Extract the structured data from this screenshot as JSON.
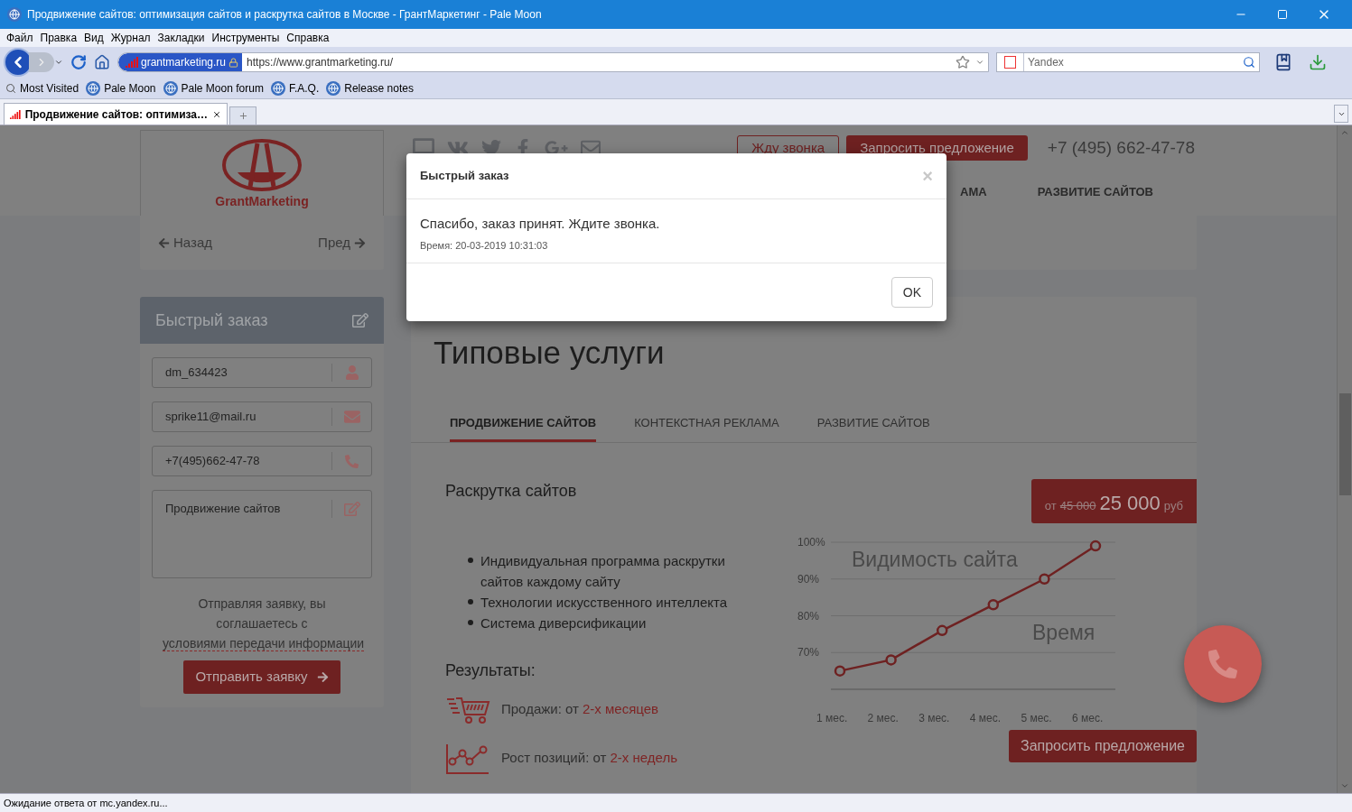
{
  "window": {
    "title": "Продвижение сайтов: оптимизация сайтов и раскрутка сайтов в Москве - ГрантМаркетинг - Pale Moon"
  },
  "menu": [
    "Файл",
    "Правка",
    "Вид",
    "Журнал",
    "Закладки",
    "Инструменты",
    "Справка"
  ],
  "toolbar": {
    "site_identity": "grantmarketing.ru",
    "url": "https://www.grantmarketing.ru/",
    "search_placeholder": "Yandex"
  },
  "bookmarks": [
    "Most Visited",
    "Pale Moon",
    "Pale Moon forum",
    "F.A.Q.",
    "Release notes"
  ],
  "tabs": [
    {
      "label": "Продвижение сайтов: оптимиза…",
      "selected": true
    }
  ],
  "page": {
    "logo": "GrantMarketing",
    "header_buttons": [
      {
        "label": "Жду звонка",
        "kind": "outline"
      },
      {
        "label": "Запросить предложение",
        "kind": "filled"
      }
    ],
    "phone": "+7 (495) 662-47-78",
    "nav": [
      "АМА",
      "РАЗВИТИЕ САЙТОВ"
    ],
    "pager": {
      "prev": "Назад",
      "next": "Пред"
    },
    "quick_order": {
      "title": "Быстрый заказ",
      "fields": [
        {
          "kind": "name",
          "value": "dm_634423"
        },
        {
          "kind": "email",
          "value": "sprike11@mail.ru"
        },
        {
          "kind": "phone",
          "value": "+7(495)662-47-78"
        },
        {
          "kind": "message",
          "value": "Продвижение сайтов"
        }
      ],
      "consent": "Отправляя заявку, вы соглашаетесь с",
      "consent_link": "условиями передачи информации",
      "submit": "Отправить заявку"
    },
    "services": {
      "title": "Типовые услуги",
      "tabs": [
        {
          "label": "ПРОДВИЖЕНИЕ САЙТОВ",
          "selected": true
        },
        {
          "label": "КОНТЕКСТНАЯ РЕКЛАМА",
          "selected": false
        },
        {
          "label": "РАЗВИТИЕ САЙТОВ",
          "selected": false
        }
      ],
      "item_title": "Раскрутка сайтов",
      "price": {
        "prefix": "от",
        "old": "45 000",
        "new": "25 000",
        "currency": "руб"
      },
      "bullets": [
        "Индивидуальная программа раскрутки сайтов каждому сайту",
        "Технологии искусственного интеллекта",
        "Система диверсификации"
      ],
      "results_title": "Результаты:",
      "results": [
        {
          "kind": "cart",
          "text": "Продажи: от ",
          "highlight": "2-х месяцев"
        },
        {
          "kind": "growth",
          "text": "Рост позиций: от ",
          "highlight": "2-х недель"
        }
      ],
      "chart_data": {
        "type": "line",
        "xlabel": "Время",
        "ylabel": "Видимость сайта",
        "categories": [
          "1 мес.",
          "2 мес.",
          "3 мес.",
          "4 мес.",
          "5 мес.",
          "6 мес."
        ],
        "grid": true,
        "series": [
          {
            "color": "#6e2121",
            "marker": "circle",
            "values": [
              65,
              68,
              76,
              83,
              90,
              99
            ]
          }
        ],
        "ylim": [
          60,
          100
        ],
        "yticks": [
          {
            "value": 70,
            "label": "70%"
          },
          {
            "value": 80,
            "label": "80%"
          },
          {
            "value": 90,
            "label": "90%"
          },
          {
            "value": 100,
            "label": "100%"
          }
        ]
      },
      "cta": "Запросить предложение"
    }
  },
  "modal": {
    "title": "Быстрый заказ",
    "close": "×",
    "message": "Спасибо, заказ принят. Ждите звонка.",
    "time": "Время: 20-03-2019 10:31:03",
    "ok": "OK"
  },
  "status_bar": "Ожидание ответа от mc.yandex.ru..."
}
